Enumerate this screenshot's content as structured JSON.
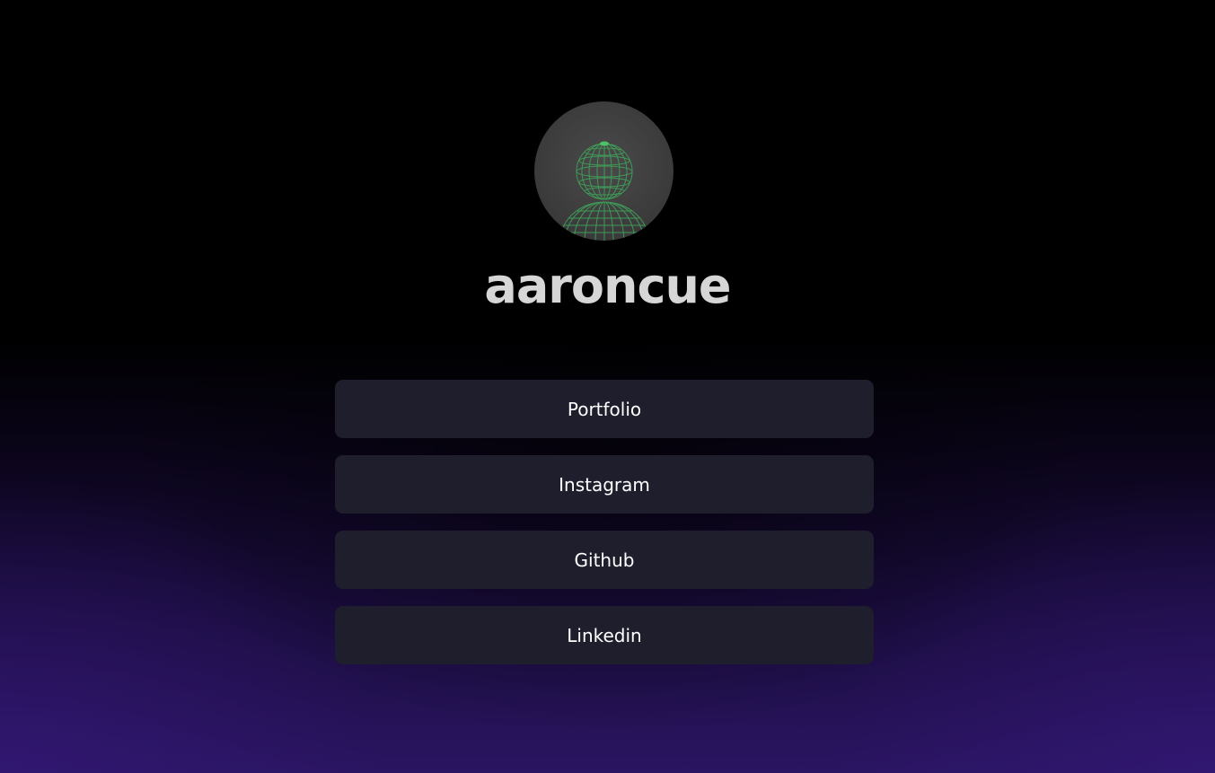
{
  "profile": {
    "avatar_icon": "wireframe-globe-figure-icon",
    "username": "aaroncue"
  },
  "links": [
    {
      "label": "Portfolio"
    },
    {
      "label": "Instagram"
    },
    {
      "label": "Github"
    },
    {
      "label": "Linkedin"
    }
  ],
  "colors": {
    "background_top": "#000000",
    "background_bottom": "#2a1562",
    "button_bg": "#1e1e2c",
    "button_text": "#ffffff",
    "name_text": "#d6d6d6",
    "avatar_wire": "#3fa35a"
  }
}
